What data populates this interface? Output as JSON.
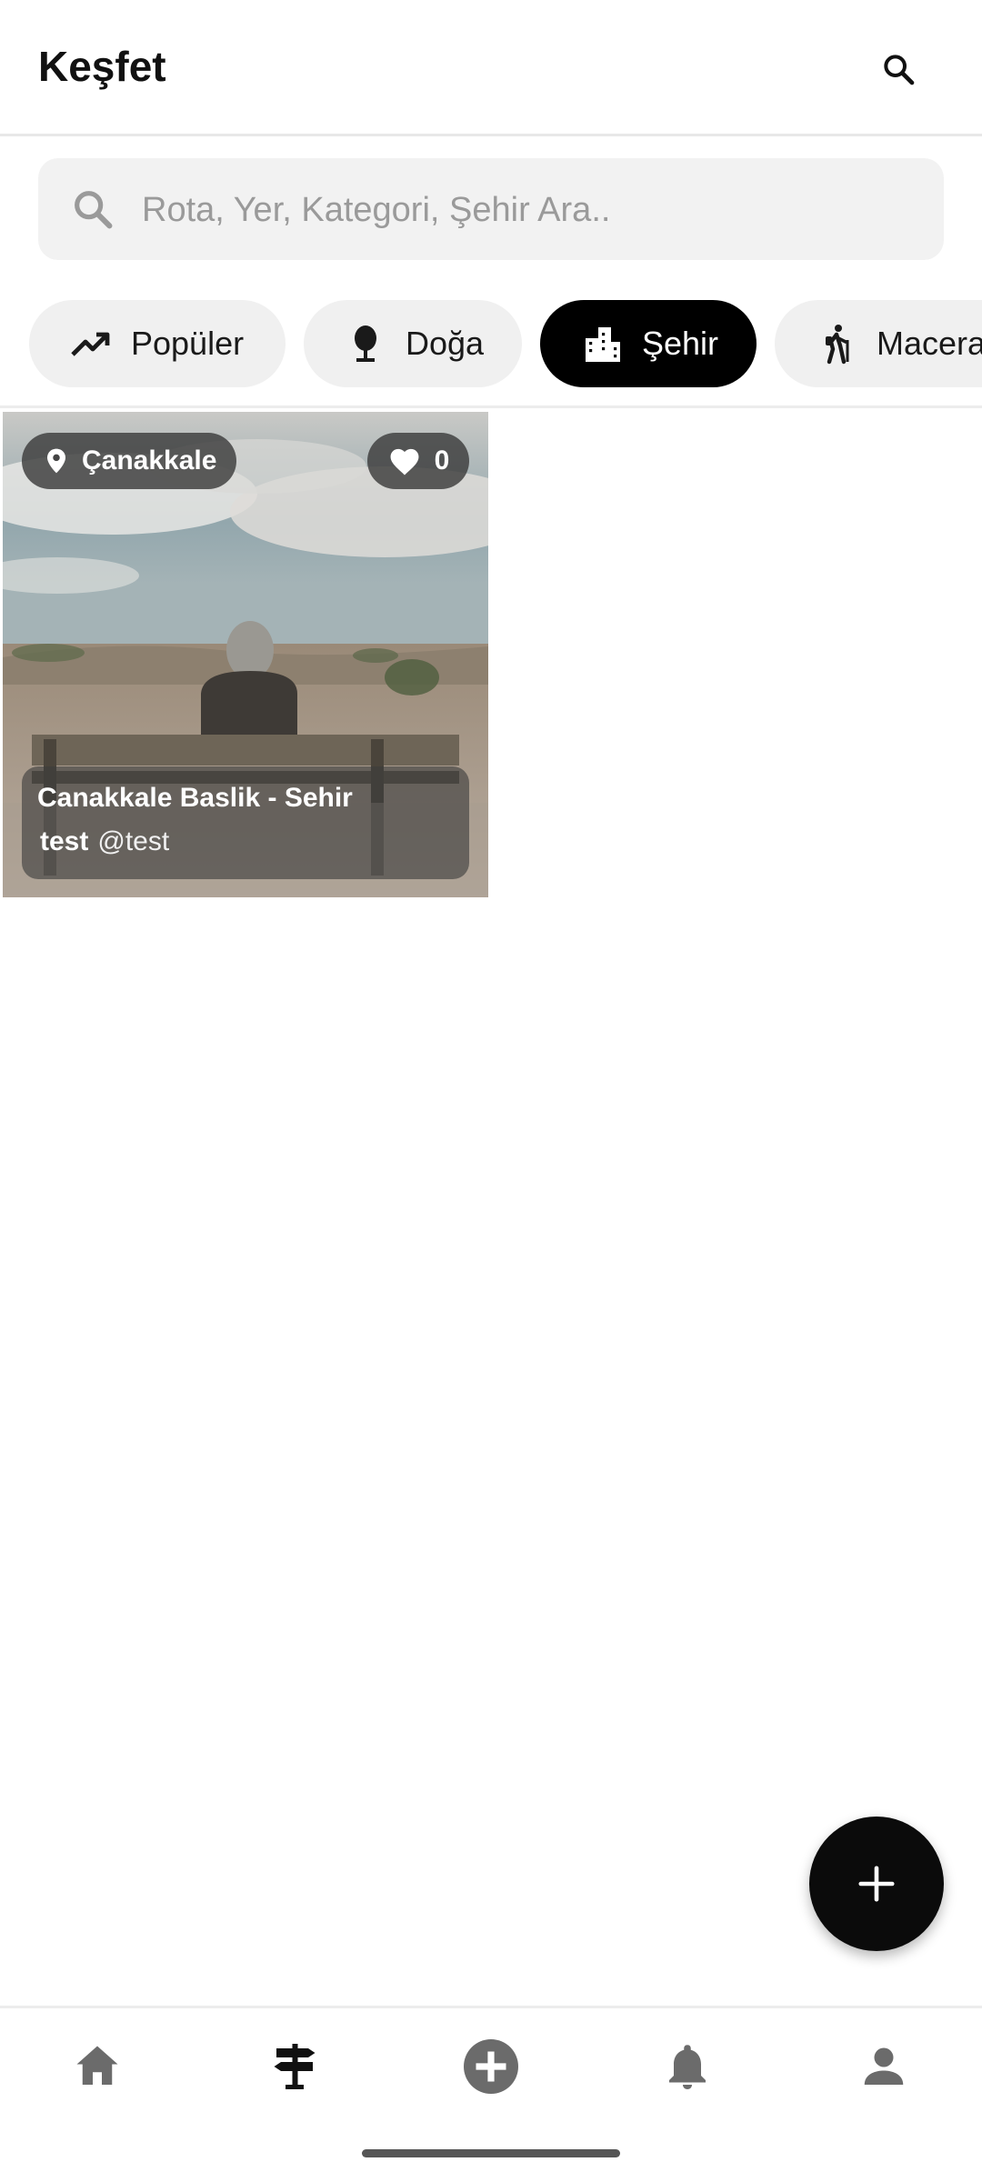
{
  "app_bar": {
    "title": "Keşfet"
  },
  "search": {
    "placeholder": "Rota, Yer, Kategori, Şehir Ara..",
    "value": ""
  },
  "categories": [
    {
      "label": "Popüler",
      "icon": "trending-up-icon",
      "active": false
    },
    {
      "label": "Doğa",
      "icon": "tree-icon",
      "active": false
    },
    {
      "label": "Şehir",
      "icon": "city-icon",
      "active": true
    },
    {
      "label": "Macera",
      "icon": "hiking-icon",
      "active": false
    }
  ],
  "feed": {
    "cards": [
      {
        "location": "Çanakkale",
        "likes": "0",
        "title": "Canakkale Baslik - Sehir",
        "author_name": "test",
        "author_handle": "@test"
      }
    ]
  },
  "bottom_nav": {
    "items": [
      "home-icon",
      "route-signpost-icon",
      "add-circle-icon",
      "bell-icon",
      "profile-icon"
    ],
    "active_index": 1
  },
  "colors": {
    "accent": "#000000",
    "chip_bg": "#f0f0f0",
    "search_bg": "#f2f2f2",
    "nav_inactive": "#6b6b6b"
  }
}
